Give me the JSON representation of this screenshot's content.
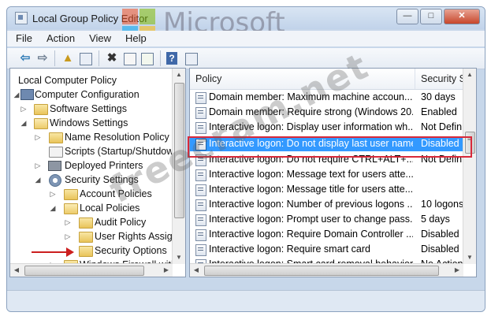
{
  "window": {
    "title": "Local Group Policy Editor",
    "buttons": {
      "minimize": "—",
      "maximize": "□",
      "close": "✕"
    }
  },
  "watermark": {
    "brand": "Microsoft",
    "site": "freecram.net"
  },
  "menu": [
    "File",
    "Action",
    "View",
    "Help"
  ],
  "toolbar": {
    "icons": [
      "back-icon",
      "forward-icon",
      "up-icon",
      "show-hide-tree-icon",
      "delete-icon",
      "properties-icon",
      "export-icon",
      "help-icon",
      "console-icon"
    ]
  },
  "tree": {
    "nodes": [
      {
        "label": "Local Computer Policy",
        "level": 0,
        "expander": "",
        "icon": "computer-policy"
      },
      {
        "label": "Computer Configuration",
        "level": 0,
        "expander": "◢",
        "icon": "computer"
      },
      {
        "label": "Software Settings",
        "level": 1,
        "expander": "▷",
        "icon": "folder"
      },
      {
        "label": "Windows Settings",
        "level": 1,
        "expander": "◢",
        "icon": "folder-open"
      },
      {
        "label": "Name Resolution Policy",
        "level": 2,
        "expander": "▷",
        "icon": "folder"
      },
      {
        "label": "Scripts (Startup/Shutdow",
        "level": 2,
        "expander": "",
        "icon": "scripts"
      },
      {
        "label": "Deployed Printers",
        "level": 2,
        "expander": "▷",
        "icon": "printer"
      },
      {
        "label": "Security Settings",
        "level": 2,
        "expander": "◢",
        "icon": "security"
      },
      {
        "label": "Account Policies",
        "level": 3,
        "expander": "▷",
        "icon": "folder"
      },
      {
        "label": "Local Policies",
        "level": 3,
        "expander": "◢",
        "icon": "folder-open"
      },
      {
        "label": "Audit Policy",
        "level": 4,
        "expander": "▷",
        "icon": "folder"
      },
      {
        "label": "User Rights Assigr",
        "level": 4,
        "expander": "▷",
        "icon": "folder"
      },
      {
        "label": "Security Options",
        "level": 4,
        "expander": "",
        "icon": "folder"
      },
      {
        "label": "Windows Firewall with",
        "level": 3,
        "expander": "▷",
        "icon": "folder"
      }
    ]
  },
  "list": {
    "columns": [
      "Policy",
      "Security S"
    ],
    "rows": [
      {
        "policy": "Domain member: Maximum machine accoun...",
        "setting": "30 days",
        "selected": false
      },
      {
        "policy": "Domain member: Require strong (Windows 20...",
        "setting": "Enabled",
        "selected": false
      },
      {
        "policy": "Interactive logon: Display user information wh...",
        "setting": "Not Defin",
        "selected": false
      },
      {
        "policy": "Interactive logon: Do not display last user name",
        "setting": "Disabled",
        "selected": true
      },
      {
        "policy": "Interactive logon: Do not require CTRL+ALT+...",
        "setting": "Not Defin",
        "selected": false
      },
      {
        "policy": "Interactive logon: Message text for users atte...",
        "setting": "",
        "selected": false
      },
      {
        "policy": "Interactive logon: Message title for users atte...",
        "setting": "",
        "selected": false
      },
      {
        "policy": "Interactive logon: Number of previous logons ...",
        "setting": "10 logons",
        "selected": false
      },
      {
        "policy": "Interactive logon: Prompt user to change pass...",
        "setting": "5 days",
        "selected": false
      },
      {
        "policy": "Interactive logon: Require Domain Controller ...",
        "setting": "Disabled",
        "selected": false
      },
      {
        "policy": "Interactive logon: Require smart card",
        "setting": "Disabled",
        "selected": false
      },
      {
        "policy": "Interactive logon: Smart card removal behavior",
        "setting": "No Action",
        "selected": false
      }
    ]
  },
  "colors": {
    "selection": "#3399ff",
    "highlight_box": "#d8293a",
    "annotation_arrow": "#cc1f1f"
  }
}
